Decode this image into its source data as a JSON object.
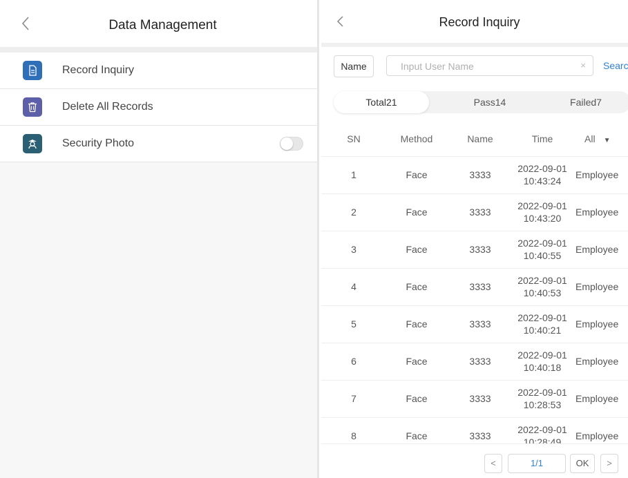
{
  "left": {
    "title": "Data Management",
    "items": [
      {
        "label": "Record Inquiry",
        "icon": "document-icon",
        "color": "#2e6fb8"
      },
      {
        "label": "Delete All Records",
        "icon": "trash-icon",
        "color": "#5d5fa8"
      },
      {
        "label": "Security Photo",
        "icon": "security-guard-icon",
        "color": "#2b5f73",
        "toggle": false
      }
    ]
  },
  "right": {
    "title": "Record Inquiry",
    "search": {
      "field_label": "Name",
      "placeholder": "Input User Name",
      "clear": "×",
      "action": "Searc"
    },
    "tabs": [
      {
        "label": "Total21",
        "active": true
      },
      {
        "label": "Pass14",
        "active": false
      },
      {
        "label": "Failed7",
        "active": false
      }
    ],
    "columns": [
      "SN",
      "Method",
      "Name",
      "Time",
      "All"
    ],
    "rows": [
      {
        "sn": "1",
        "method": "Face",
        "name": "3333",
        "date": "2022-09-01",
        "time": "10:43:24",
        "type": "Employee"
      },
      {
        "sn": "2",
        "method": "Face",
        "name": "3333",
        "date": "2022-09-01",
        "time": "10:43:20",
        "type": "Employee"
      },
      {
        "sn": "3",
        "method": "Face",
        "name": "3333",
        "date": "2022-09-01",
        "time": "10:40:55",
        "type": "Employee"
      },
      {
        "sn": "4",
        "method": "Face",
        "name": "3333",
        "date": "2022-09-01",
        "time": "10:40:53",
        "type": "Employee"
      },
      {
        "sn": "5",
        "method": "Face",
        "name": "3333",
        "date": "2022-09-01",
        "time": "10:40:21",
        "type": "Employee"
      },
      {
        "sn": "6",
        "method": "Face",
        "name": "3333",
        "date": "2022-09-01",
        "time": "10:40:18",
        "type": "Employee"
      },
      {
        "sn": "7",
        "method": "Face",
        "name": "3333",
        "date": "2022-09-01",
        "time": "10:28:53",
        "type": "Employee"
      },
      {
        "sn": "8",
        "method": "Face",
        "name": "3333",
        "date": "2022-09-01",
        "time": "10:28:49",
        "type": "Employee"
      }
    ],
    "pager": {
      "prev": "<",
      "page": "1/1",
      "ok": "OK",
      "next": ">"
    }
  },
  "accent_color": "#2f80d6"
}
